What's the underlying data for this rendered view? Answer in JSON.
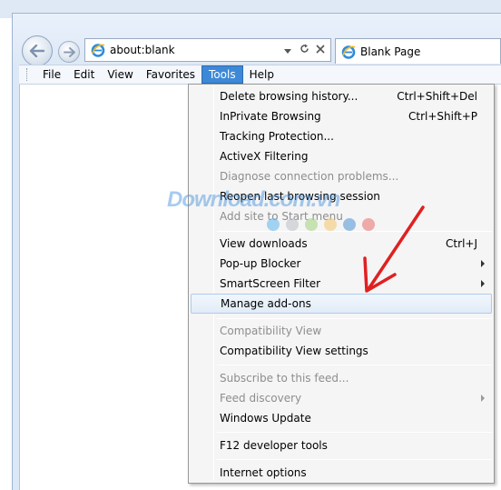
{
  "browser": {
    "address": "about:blank",
    "tab_title": "Blank Page"
  },
  "menubar": {
    "items": [
      {
        "label": "File"
      },
      {
        "label": "Edit"
      },
      {
        "label": "View"
      },
      {
        "label": "Favorites"
      },
      {
        "label": "Tools",
        "active": true
      },
      {
        "label": "Help"
      }
    ]
  },
  "tools_menu": {
    "items": [
      {
        "label": "Delete browsing history...",
        "shortcut": "Ctrl+Shift+Del"
      },
      {
        "label": "InPrivate Browsing",
        "shortcut": "Ctrl+Shift+P"
      },
      {
        "label": "Tracking Protection..."
      },
      {
        "label": "ActiveX Filtering"
      },
      {
        "label": "Diagnose connection problems...",
        "disabled": true
      },
      {
        "label": "Reopen last browsing session"
      },
      {
        "label": "Add site to Start menu",
        "disabled": true
      },
      {
        "label": "View downloads",
        "shortcut": "Ctrl+J"
      },
      {
        "label": "Pop-up Blocker",
        "submenu": true
      },
      {
        "label": "SmartScreen Filter",
        "submenu": true
      },
      {
        "label": "Manage add-ons",
        "highlighted": true
      },
      {
        "label": "Compatibility View",
        "disabled": true
      },
      {
        "label": "Compatibility View settings"
      },
      {
        "label": "Subscribe to this feed...",
        "disabled": true
      },
      {
        "label": "Feed discovery",
        "disabled": true,
        "submenu": true
      },
      {
        "label": "Windows Update"
      },
      {
        "label": "F12 developer tools"
      },
      {
        "label": "Internet options"
      }
    ]
  },
  "watermark": {
    "text": "Download.com.vn",
    "dot_colors": [
      "#5bb5ec",
      "#b9bec4",
      "#9fd27a",
      "#f4c56a",
      "#4a8fd6",
      "#e86a6a"
    ]
  },
  "colors": {
    "menu_active": "#3d89d7",
    "highlight_border": "#aecbeb",
    "annotation_arrow": "#e02020"
  }
}
